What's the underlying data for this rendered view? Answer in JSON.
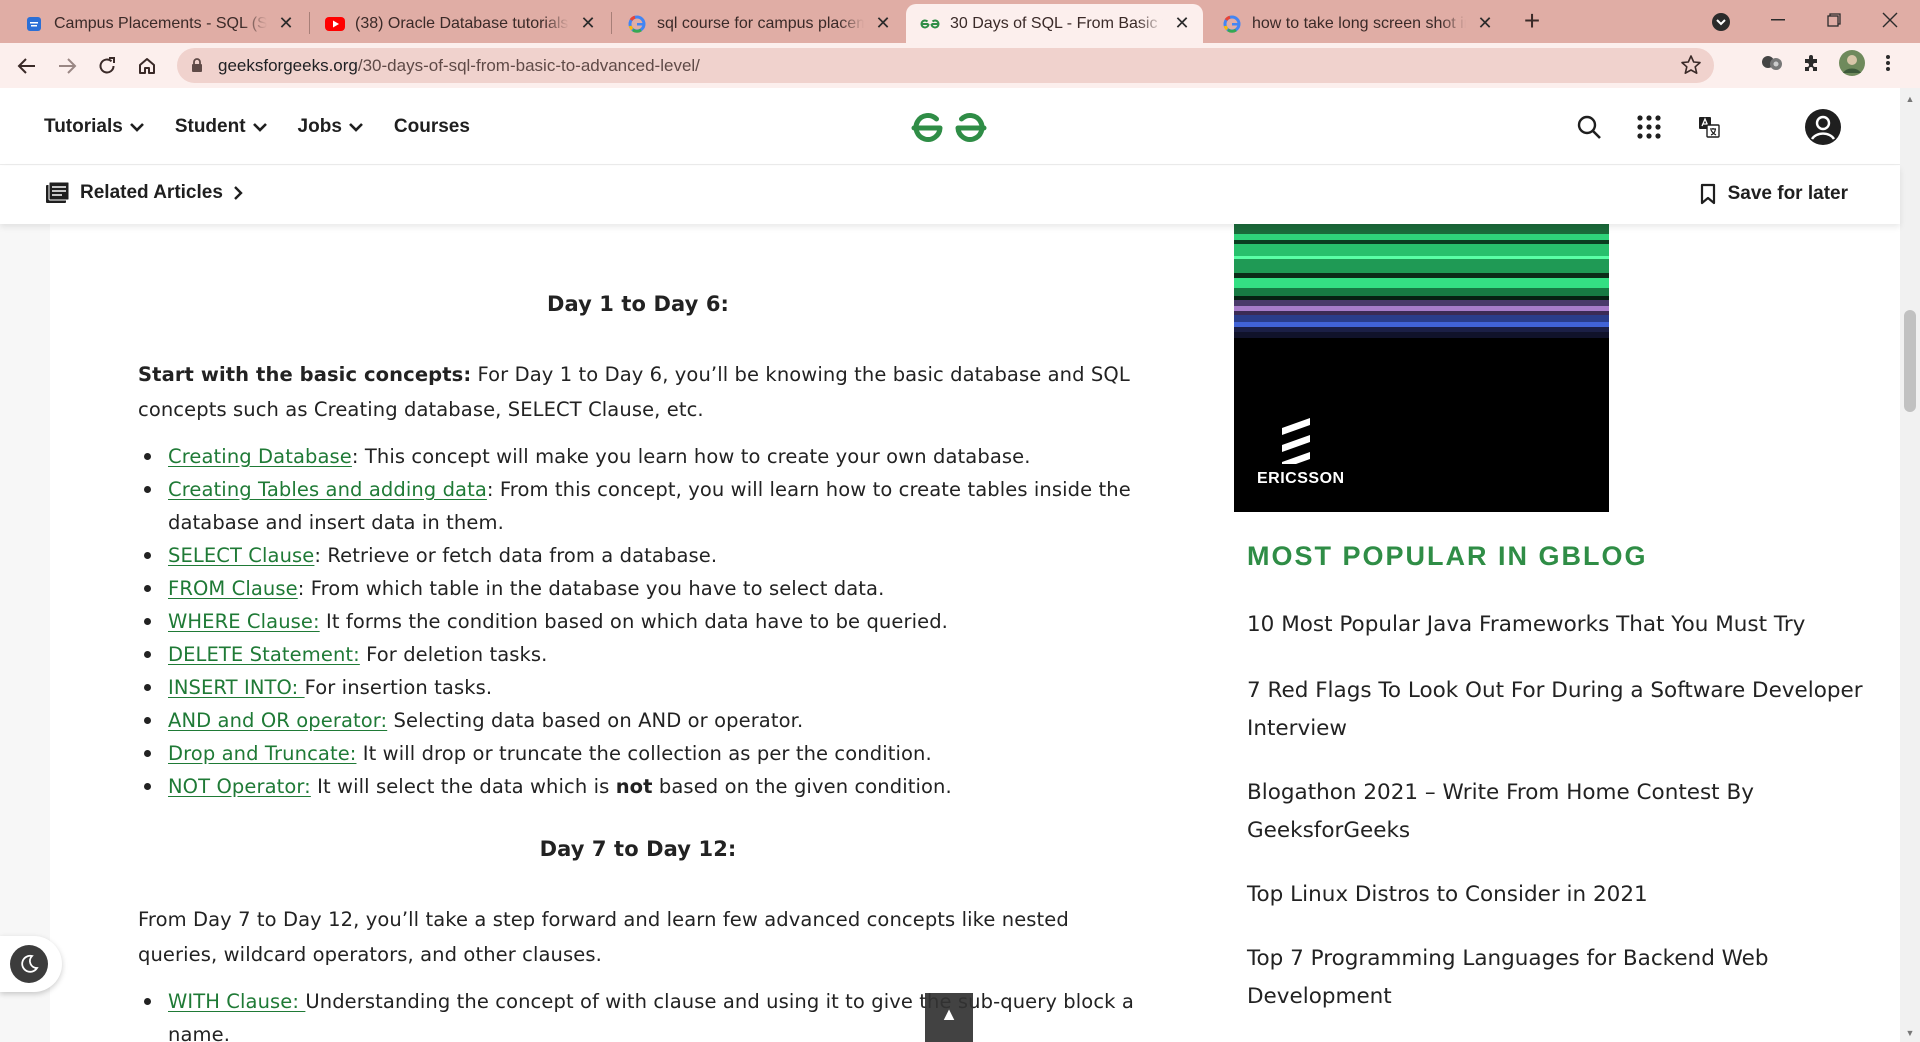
{
  "browser": {
    "tabs": [
      {
        "title": "Campus Placements - SQL (Struct",
        "icon": "document-favicon-icon"
      },
      {
        "title": "(38) Oracle Database tutorials 1: I",
        "icon": "youtube-favicon-icon"
      },
      {
        "title": "sql course for campus placement",
        "icon": "google-favicon-icon"
      },
      {
        "title": "30 Days of SQL - From Basic to A",
        "icon": "gfg-favicon-icon"
      },
      {
        "title": "how to take long screen shot in w",
        "icon": "google-favicon-icon"
      }
    ],
    "url_domain": "geeksforgeeks.org",
    "url_path": "/30-days-of-sql-from-basic-to-advanced-level/",
    "accent": "#e0ada5"
  },
  "site": {
    "nav": [
      {
        "label": "Tutorials",
        "dropdown": true
      },
      {
        "label": "Student",
        "dropdown": true
      },
      {
        "label": "Jobs",
        "dropdown": true
      },
      {
        "label": "Courses",
        "dropdown": false
      }
    ],
    "related_label": "Related Articles",
    "save_label": "Save for later",
    "brand_color": "#2f8d46"
  },
  "article": {
    "section1_heading": "Day 1 to Day 6:",
    "section1_intro_bold": "Start with the basic concepts:",
    "section1_intro_rest": " For Day 1 to Day 6, you’ll be knowing the basic database and SQL concepts such as Creating database, SELECT Clause, etc.",
    "section1_items": [
      {
        "link": "Creating Database",
        "text": ": This concept will make you learn how to create your own database."
      },
      {
        "link": "Creating Tables and adding data",
        "text": ": From this concept, you will learn how to create tables inside the database and insert data in them."
      },
      {
        "link": "SELECT Clause",
        "text": ": Retrieve or fetch data from a database."
      },
      {
        "link": "FROM Clause",
        "text": ": From which table in the database you have to select data."
      },
      {
        "link": "WHERE Clause:",
        "text": " It forms the condition based on which data have to be queried."
      },
      {
        "link": "DELETE Statement:",
        "text": " For deletion tasks."
      },
      {
        "link": "INSERT INTO: ",
        "text": "For insertion tasks."
      },
      {
        "link": "AND and OR operator:",
        "text": " Selecting data based on AND or operator."
      },
      {
        "link": "Drop and Truncate:",
        "text": " It will drop or truncate the collection as per the condition."
      },
      {
        "link": "NOT Operator:",
        "text": " It will select the data which is ",
        "bold": "not",
        "text_after": " based on the given condition."
      }
    ],
    "section2_heading": "Day 7 to Day 12:",
    "section2_intro": "From Day 7 to Day 12, you’ll take a step forward and learn few advanced concepts like nested queries, wildcard operators, and other clauses.",
    "section2_items": [
      {
        "link": "WITH Clause: ",
        "text": "Understanding the concept of with clause and using it to give the sub-query block a name."
      }
    ]
  },
  "sidebar": {
    "ad_brand": "ERICSSON",
    "popular_heading": "MOST POPULAR IN GBLOG",
    "popular_items": [
      "10 Most Popular Java Frameworks That You Must Try",
      "7 Red Flags To Look Out For During a Software Developer Interview",
      "Blogathon 2021 – Write From Home Contest By GeeksforGeeks",
      "Top Linux Distros to Consider in 2021",
      "Top 7 Programming Languages for Backend Web Development"
    ]
  }
}
